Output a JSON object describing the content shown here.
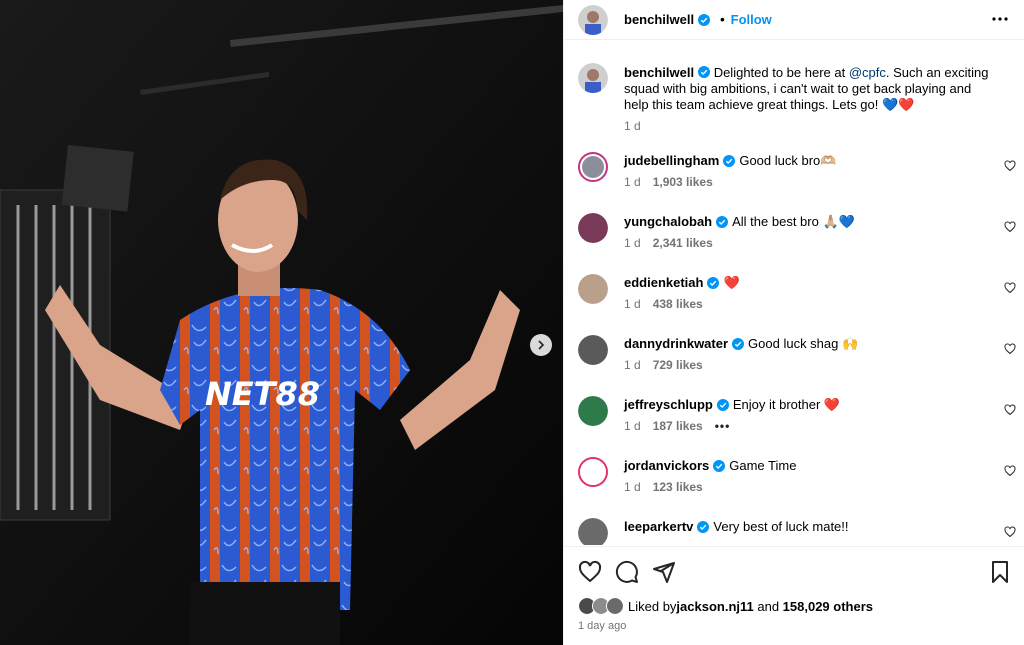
{
  "post": {
    "author": "benchilwell",
    "follow_label": "Follow",
    "dot": "•"
  },
  "caption": {
    "username": "benchilwell",
    "text_before": " Delighted to be here at ",
    "mention": "@cpfc",
    "text_after": ". Such an exciting squad with big ambitions, i can't wait to get back playing and help this team achieve great things. Lets go! 💙❤️",
    "time": "1 d"
  },
  "comments": [
    {
      "username": "judebellingham",
      "text": "Good luck bro🫶🏼",
      "time": "1 d",
      "likes": "1,903 likes",
      "avatar_color": "#8a8f9a"
    },
    {
      "username": "yungchalobah",
      "text": "All the best bro 🙏🏼💙",
      "time": "1 d",
      "likes": "2,341 likes",
      "avatar_color": "#7a3a5a"
    },
    {
      "username": "eddienketiah",
      "text": "❤️",
      "time": "1 d",
      "likes": "438 likes",
      "avatar_color": "#b8a08a"
    },
    {
      "username": "dannydrinkwater",
      "text": "Good luck shag 🙌",
      "time": "1 d",
      "likes": "729 likes",
      "avatar_color": "#5a5a5a"
    },
    {
      "username": "jeffreyschlupp",
      "text": "Enjoy it brother ❤️",
      "time": "1 d",
      "likes": "187 likes",
      "avatar_color": "#2f7a4a",
      "more": "•••"
    },
    {
      "username": "jordanvickors",
      "text": "Game Time",
      "time": "1 d",
      "likes": "123 likes",
      "avatar_color": "#ffffff"
    },
    {
      "username": "leeparkertv",
      "text": "Very best of luck mate!!",
      "time": "",
      "likes": "",
      "avatar_color": "#6a6a6a"
    }
  ],
  "footer": {
    "liked_prefix": "Liked by ",
    "liked_user": "jackson.nj11",
    "liked_mid": " and ",
    "liked_count": "158,029 others",
    "date": "1 day ago"
  },
  "colors": {
    "accent": "#0095f6",
    "verified": "#0095f6",
    "secondary_text": "#737373"
  },
  "icons": {
    "more": "more-horizontal-icon",
    "heart": "heart-outline-icon",
    "comment": "comment-icon",
    "share": "share-icon",
    "save": "bookmark-icon",
    "next": "chevron-right-icon"
  }
}
